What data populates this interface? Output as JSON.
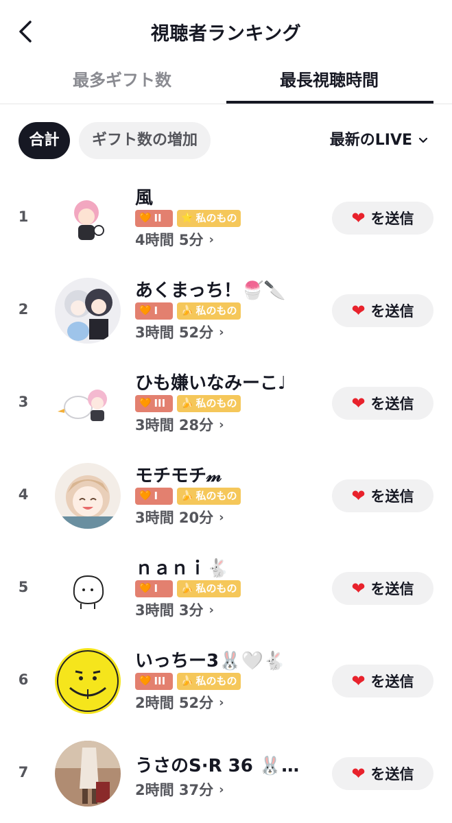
{
  "header": {
    "title": "視聴者ランキング",
    "back_icon": "chevron-left-icon"
  },
  "tabs": [
    {
      "label": "最多ギフト数",
      "active": false
    },
    {
      "label": "最長視聴時間",
      "active": true
    }
  ],
  "filters": {
    "total": "合計",
    "gift_increase": "ギフト数の増加",
    "dropdown": "最新のLIVE"
  },
  "send_label": "を送信",
  "colors": {
    "heart": "#e8222c",
    "fan_badge": "#e3806f",
    "mine_badge": "#f5c75a",
    "dark": "#161823"
  },
  "viewers": [
    {
      "rank": "1",
      "name": "風",
      "fan_level": "II",
      "mine_label": "私のもの",
      "duration": "4時間 5分"
    },
    {
      "rank": "2",
      "name": "あくまっち！🍧🔪",
      "fan_level": "I",
      "mine_label": "私のもの",
      "duration": "3時間 52分"
    },
    {
      "rank": "3",
      "name": "ひも嫌いなみーこ♩",
      "fan_level": "III",
      "mine_label": "私のもの",
      "duration": "3時間 28分"
    },
    {
      "rank": "4",
      "name": "モチモチ𝓂",
      "fan_level": "I",
      "mine_label": "私のもの",
      "duration": "3時間 20分"
    },
    {
      "rank": "5",
      "name": "ｎａｎｉ🐇",
      "fan_level": "I",
      "mine_label": "私のもの",
      "duration": "3時間 3分"
    },
    {
      "rank": "6",
      "name": "いっちー3🐰🤍🐇",
      "fan_level": "III",
      "mine_label": "私のもの",
      "duration": "2時間 52分"
    },
    {
      "rank": "7",
      "name": "うさのS·R 36 🐰…",
      "fan_level": "",
      "mine_label": "",
      "duration": "2時間 37分"
    }
  ]
}
